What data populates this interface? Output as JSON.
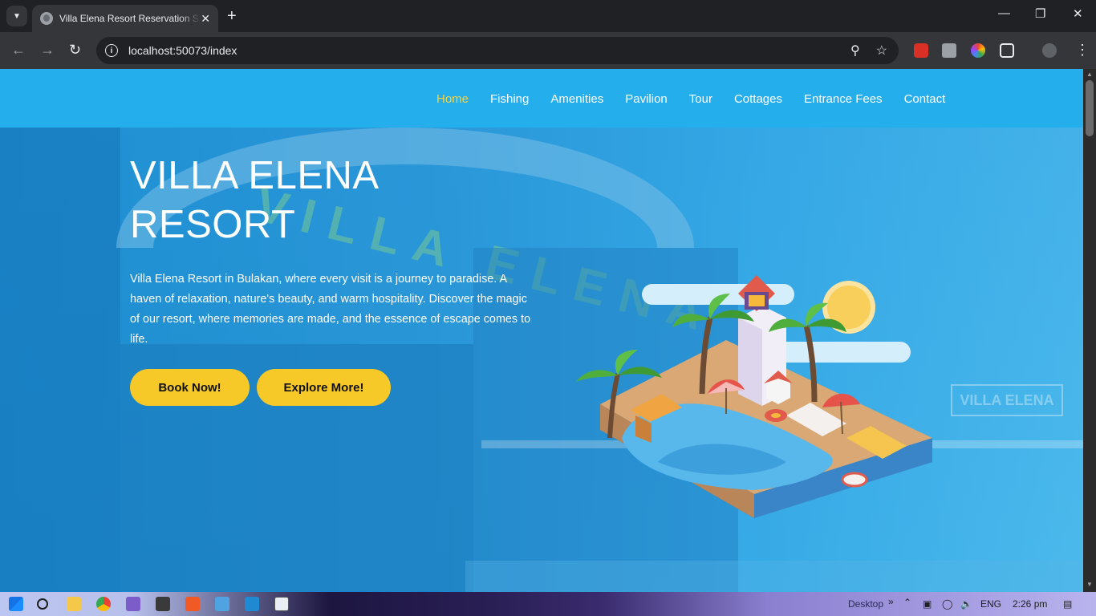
{
  "browser": {
    "tab_title": "Villa Elena Resort Reservation Sy",
    "url": "localhost:50073/index",
    "new_tab": "+",
    "tab_close": "✕"
  },
  "navbar": {
    "items": [
      {
        "label": "Home",
        "active": true
      },
      {
        "label": "Fishing"
      },
      {
        "label": "Amenities"
      },
      {
        "label": "Pavilion"
      },
      {
        "label": "Tour"
      },
      {
        "label": "Cottages"
      },
      {
        "label": "Entrance Fees"
      },
      {
        "label": "Contact"
      }
    ]
  },
  "hero": {
    "title_line1": "VILLA ELENA",
    "title_line2": "RESORT",
    "description": "Villa Elena Resort in Bulakan, where every visit is a journey to paradise. A haven of relaxation, nature's beauty, and warm hospitality. Discover the magic of our resort, where memories are made, and the essence of escape comes to life.",
    "book_button": "Book Now!",
    "explore_button": "Explore More!",
    "sign_text": "VILLA ELENA"
  },
  "taskbar": {
    "desktop_label": "Desktop",
    "language": "ENG",
    "time": "2:26 pm"
  },
  "colors": {
    "navbar_bg": "#24aeec",
    "active_link": "#f7d23d",
    "button_bg": "#f7c928"
  }
}
